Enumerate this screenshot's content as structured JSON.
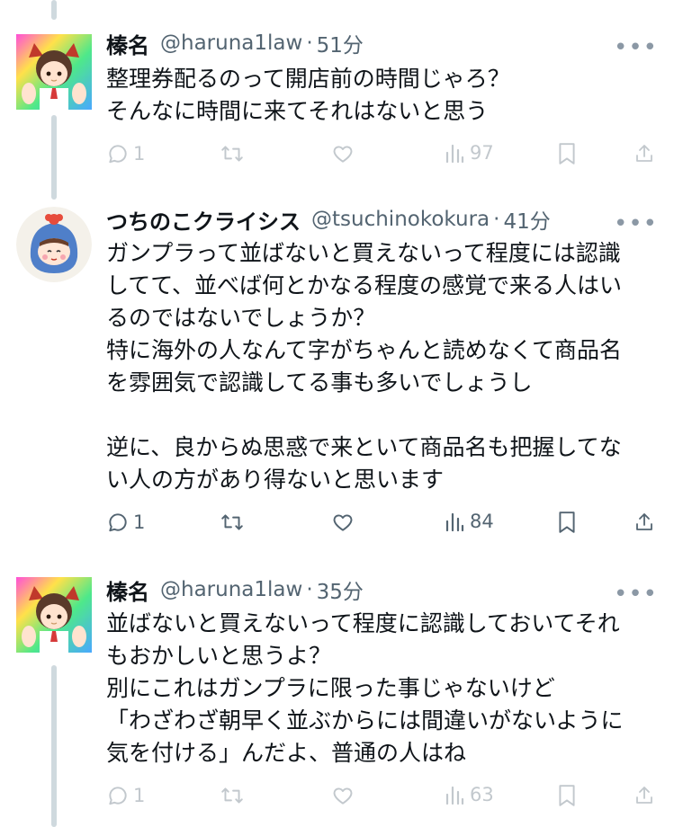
{
  "tweets": [
    {
      "name": "榛名",
      "handle": "@haruna1law",
      "time": "51分",
      "body": "整理券配るのって開店前の時間じゃろ？\nそんなに時間に来てそれはないと思う",
      "actions": {
        "replies": "1",
        "views": "97"
      }
    },
    {
      "name": "つちのこクライシス",
      "handle": "@tsuchinokokura",
      "time": "41分",
      "body": "ガンプラって並ばないと買えないって程度には認識してて、並べば何とかなる程度の感覚で来る人はいるのではないでしょうか？\n特に海外の人なんて字がちゃんと読めなくて商品名を雰囲気で認識してる事も多いでしょうし\n\n逆に、良からぬ思惑で来といて商品名も把握してない人の方があり得ないと思います",
      "actions": {
        "replies": "1",
        "views": "84"
      }
    },
    {
      "name": "榛名",
      "handle": "@haruna1law",
      "time": "35分",
      "body": "並ばないと買えないって程度に認識しておいてそれもおかしいと思うよ？\n別にこれはガンプラに限った事じゃないけど\n「わざわざ朝早く並ぶからには間違いがないように気を付ける」んだよ、普通の人はね",
      "actions": {
        "replies": "1",
        "views": "63"
      }
    }
  ],
  "separator": "·",
  "more_glyph": "•••",
  "colors": {
    "text": "#0f1419",
    "secondary": "#536471",
    "thread_line": "#cfd9de"
  }
}
